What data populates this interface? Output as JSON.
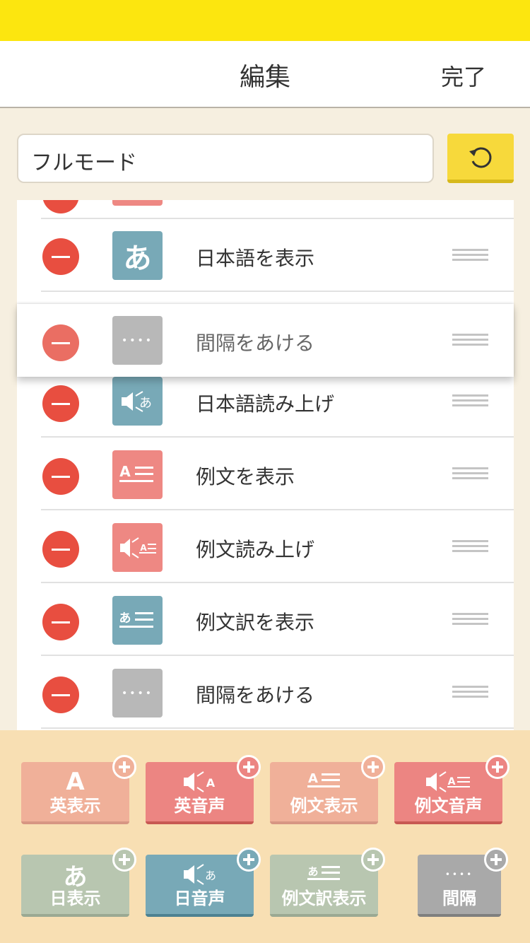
{
  "header": {
    "title": "編集",
    "done_label": "完了"
  },
  "mode": {
    "value": "フルモード"
  },
  "list": {
    "items": [
      {
        "label": "日本語を表示",
        "icon": "hiragana-a-icon",
        "color": "#78a9b7"
      },
      {
        "label": "日本語読み上げ",
        "icon": "speaker-hiragana-icon",
        "color": "#78a9b7"
      },
      {
        "label": "例文を表示",
        "icon": "example-text-icon",
        "color": "#ee8883"
      },
      {
        "label": "例文読み上げ",
        "icon": "speaker-example-icon",
        "color": "#ee8883"
      },
      {
        "label": "例文訳を表示",
        "icon": "translation-text-icon",
        "color": "#78a9b7"
      },
      {
        "label": "間隔をあける",
        "icon": "dots-icon",
        "color": "#b8b8b8"
      }
    ],
    "dragging": {
      "label": "間隔をあける",
      "icon": "dots-icon"
    }
  },
  "palette": {
    "buttons": [
      {
        "label": "英表示",
        "icon": "letter-a-icon",
        "color": "#f0b099"
      },
      {
        "label": "英音声",
        "icon": "speaker-letter-a-icon",
        "color": "#ec8582"
      },
      {
        "label": "例文表示",
        "icon": "example-text-icon",
        "color": "#f0b099"
      },
      {
        "label": "例文音声",
        "icon": "speaker-example-icon",
        "color": "#ec8582"
      },
      {
        "label": "日表示",
        "icon": "hiragana-a-icon",
        "color": "#b8c6b0"
      },
      {
        "label": "日音声",
        "icon": "speaker-hiragana-icon",
        "color": "#78a9b7"
      },
      {
        "label": "例文訳表示",
        "icon": "translation-text-icon",
        "color": "#b8c6b0"
      },
      {
        "label": "間隔",
        "icon": "dots-icon",
        "color": "#a9a9a9"
      }
    ]
  },
  "icon_glyphs": {
    "hiragana": "あ",
    "letter": "A",
    "dots": "••••"
  }
}
